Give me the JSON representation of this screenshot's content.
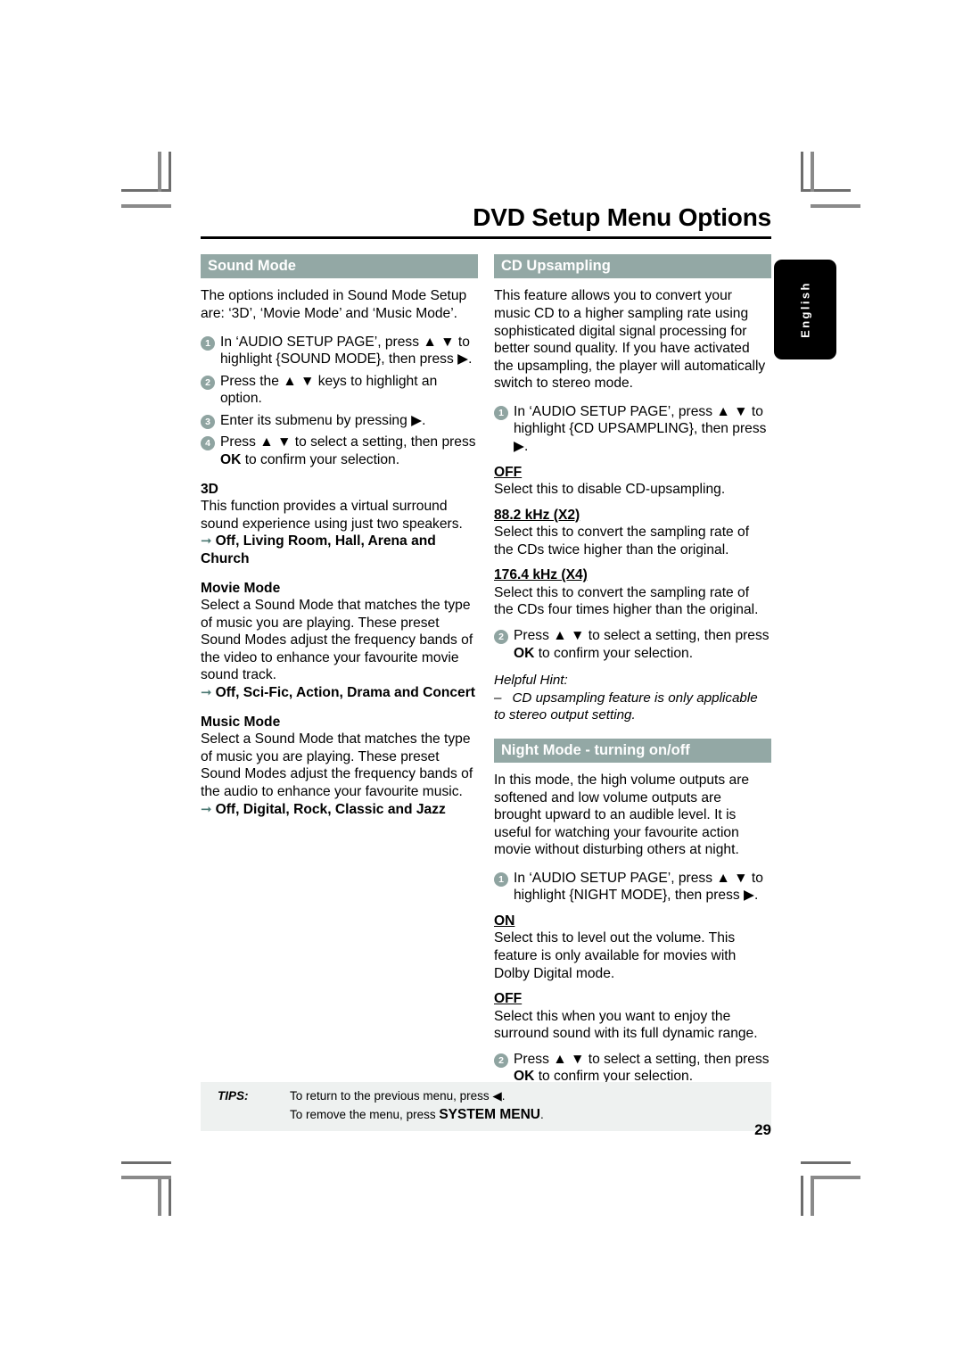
{
  "page": {
    "title": "DVD Setup Menu Options",
    "number": "29",
    "language_tab": "English"
  },
  "left_column": {
    "section": {
      "heading": "Sound Mode",
      "intro": "The options included in Sound Mode Setup are: ‘3D’, ‘Movie Mode’ and ‘Music Mode’.",
      "steps": [
        {
          "num": "1",
          "text_before": "In ‘AUDIO SETUP PAGE’, press ",
          "keys": "▲ ▼",
          "text_after": " to highlight {SOUND MODE}, then press ▶."
        },
        {
          "num": "2",
          "text_before": "Press the ",
          "keys": "▲ ▼",
          "text_after": " keys to highlight an option."
        },
        {
          "num": "3",
          "text_before": "Enter its submenu by pressing ▶.",
          "keys": "",
          "text_after": ""
        },
        {
          "num": "4",
          "text_before": "Press ",
          "keys": "▲ ▼",
          "text_after": " to select a setting, then press ",
          "bold_key": "OK",
          "tail": " to confirm your selection."
        }
      ],
      "subsections": [
        {
          "title": "3D",
          "body": "This function provides a virtual surround sound experience using just two speakers.",
          "options": "Off, Living Room, Hall, Arena and Church"
        },
        {
          "title": "Movie Mode",
          "body": "Select a Sound Mode that matches the type of music you are playing. These preset Sound Modes adjust the frequency bands of the video to enhance your favourite movie sound track.",
          "options": "Off, Sci-Fic, Action, Drama and Concert"
        },
        {
          "title": "Music Mode",
          "body": "Select a Sound Mode that matches the type of music you are playing. These preset Sound Modes adjust the frequency bands of the audio to enhance your favourite music.",
          "options": "Off, Digital, Rock, Classic and Jazz"
        }
      ]
    }
  },
  "right_column": {
    "cd_upsampling": {
      "heading": "CD Upsampling",
      "intro": "This feature allows you to convert your music CD to a higher sampling rate using sophisticated digital signal processing for better sound quality. If you have activated the upsampling, the player will automatically switch to stereo mode.",
      "step1": {
        "num": "1",
        "text_before": "In ‘AUDIO SETUP PAGE’, press ",
        "keys": "▲ ▼",
        "text_after": " to highlight {CD UPSAMPLING}, then press ▶."
      },
      "options": [
        {
          "title": "OFF",
          "body": "Select this to disable CD-upsampling."
        },
        {
          "title": "88.2 kHz (X2)",
          "body": "Select this to convert the sampling rate of the CDs twice higher than the original."
        },
        {
          "title": "176.4 kHz (X4)",
          "body": "Select this to convert the sampling rate of the CDs four times higher than the original."
        }
      ],
      "step2": {
        "num": "2",
        "text_before": "Press ",
        "keys": "▲ ▼",
        "text_after": " to select a setting, then press ",
        "bold_key": "OK",
        "tail": " to confirm your selection."
      },
      "hint_title": "Helpful Hint:",
      "hint_dash": "–",
      "hint_body": "CD upsampling feature is only applicable to stereo output setting."
    },
    "night_mode": {
      "heading": "Night Mode - turning on/off",
      "intro": "In this mode, the high volume outputs are softened and low volume outputs are brought upward to an audible level.  It is useful for watching your favourite action movie without disturbing others at night.",
      "step1": {
        "num": "1",
        "text_before": "In ‘AUDIO SETUP PAGE’, press ",
        "keys": "▲ ▼",
        "text_after": " to highlight {NIGHT MODE}, then press ▶."
      },
      "options": [
        {
          "title": "ON",
          "body": "Select this to level out the volume. This feature is only available for movies with Dolby Digital mode."
        },
        {
          "title": "OFF",
          "body": "Select this when you want to enjoy the surround sound with its full dynamic range."
        }
      ],
      "step2": {
        "num": "2",
        "text_before": "Press ",
        "keys": "▲ ▼",
        "text_after": " to select a setting, then press ",
        "bold_key": "OK",
        "tail": " to confirm your selection."
      }
    }
  },
  "tips": {
    "label": "TIPS:",
    "line1": "To return to the previous menu, press ◀.",
    "line2_before": "To remove the menu, press ",
    "line2_key": "SYSTEM MENU",
    "line2_after": "."
  },
  "colors": {
    "section_header_bg": "#93a8a5",
    "bullet_bg": "#8fa4a1",
    "arrow": "#4d7a74",
    "tips_bg": "#eef1f0",
    "lang_tab_bg": "#000000"
  }
}
